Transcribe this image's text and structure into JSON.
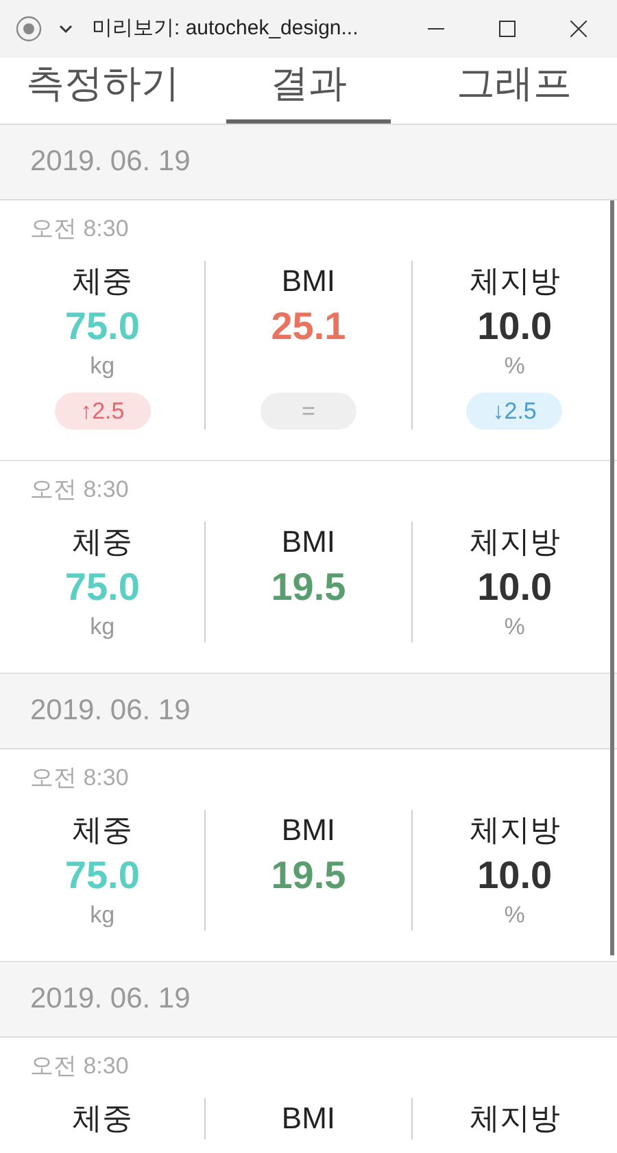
{
  "window": {
    "title": "미리보기: autochek_design..."
  },
  "tabs": [
    {
      "label": "측정하기",
      "selected": false
    },
    {
      "label": "결과",
      "selected": true
    },
    {
      "label": "그래프",
      "selected": false
    }
  ],
  "sections": [
    {
      "date": "2019. 06. 19",
      "records": [
        {
          "time": "오전 8:30",
          "metrics": [
            {
              "label": "체중",
              "value": "75.0",
              "color": "#5ccfc4",
              "unit": "kg",
              "change": {
                "kind": "up",
                "text": "↑2.5"
              }
            },
            {
              "label": "BMI",
              "value": "25.1",
              "color": "#e8735f",
              "change": {
                "kind": "same",
                "text": "="
              }
            },
            {
              "label": "체지방",
              "value": "10.0",
              "color": "#333333",
              "unit": "%",
              "change": {
                "kind": "down",
                "text": "↓2.5"
              }
            }
          ]
        },
        {
          "time": "오전 8:30",
          "metrics": [
            {
              "label": "체중",
              "value": "75.0",
              "color": "#5ccfc4",
              "unit": "kg"
            },
            {
              "label": "BMI",
              "value": "19.5",
              "color": "#5a9e6f"
            },
            {
              "label": "체지방",
              "value": "10.0",
              "color": "#333333",
              "unit": "%"
            }
          ]
        }
      ]
    },
    {
      "date": "2019. 06. 19",
      "records": [
        {
          "time": "오전 8:30",
          "metrics": [
            {
              "label": "체중",
              "value": "75.0",
              "color": "#5ccfc4",
              "unit": "kg"
            },
            {
              "label": "BMI",
              "value": "19.5",
              "color": "#5a9e6f"
            },
            {
              "label": "체지방",
              "value": "10.0",
              "color": "#333333",
              "unit": "%"
            }
          ]
        }
      ]
    },
    {
      "date": "2019. 06. 19",
      "records": [
        {
          "time": "오전 8:30",
          "metrics": [
            {
              "label": "체중"
            },
            {
              "label": "BMI"
            },
            {
              "label": "체지방"
            }
          ]
        }
      ]
    }
  ]
}
